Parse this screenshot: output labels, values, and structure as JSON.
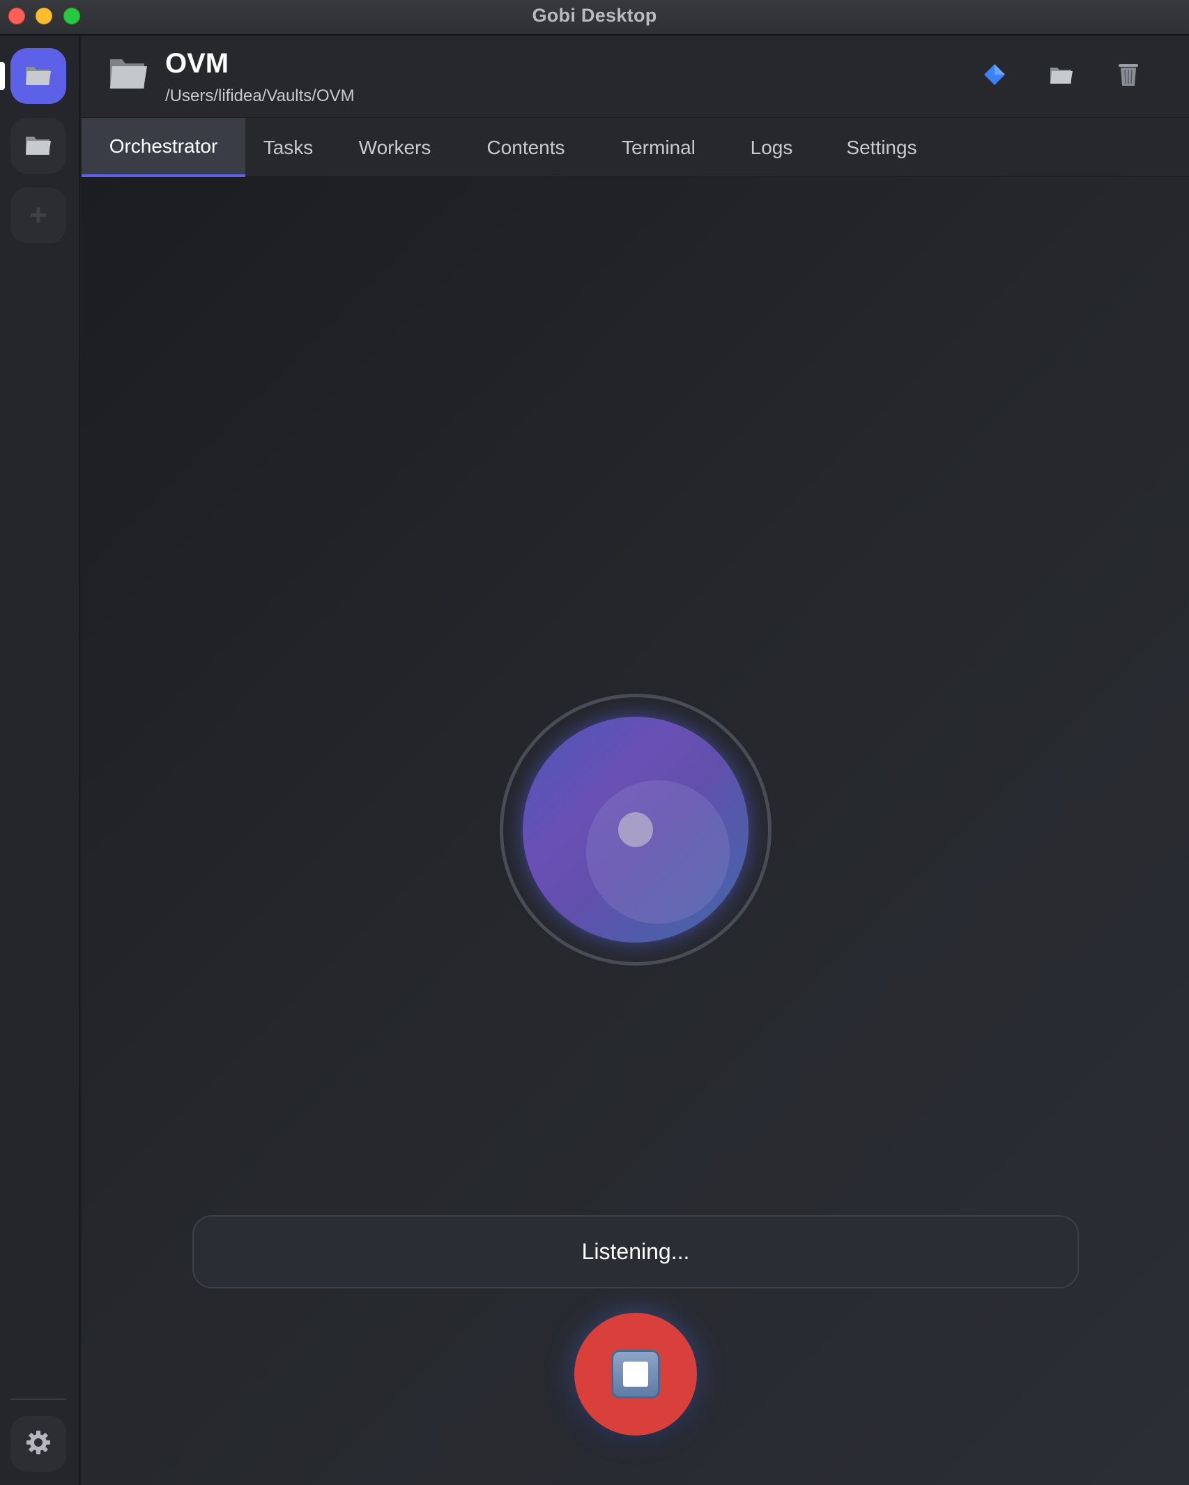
{
  "window": {
    "title": "Gobi Desktop"
  },
  "rail": {
    "items": [
      {
        "name": "vault-ovm",
        "icon": "folder-icon",
        "active": true
      },
      {
        "name": "vault-2",
        "icon": "folder-icon",
        "active": false
      }
    ],
    "add_label": "+",
    "settings_icon": "gear-icon",
    "accent": "#5c61e8"
  },
  "header": {
    "vault_name": "OVM",
    "vault_path": "/Users/lifidea/Vaults/OVM",
    "actions": [
      "diamond-icon",
      "folder-icon",
      "trash-icon"
    ]
  },
  "tabs": [
    {
      "label": "Orchestrator",
      "active": true
    },
    {
      "label": "Tasks",
      "active": false
    },
    {
      "label": "Workers",
      "active": false
    },
    {
      "label": "Contents",
      "active": false
    },
    {
      "label": "Terminal",
      "active": false
    },
    {
      "label": "Logs",
      "active": false
    },
    {
      "label": "Settings",
      "active": false
    }
  ],
  "main": {
    "status_text": "Listening...",
    "stop_button_icon": "stop-icon",
    "stop_button_color": "#d9403b"
  }
}
